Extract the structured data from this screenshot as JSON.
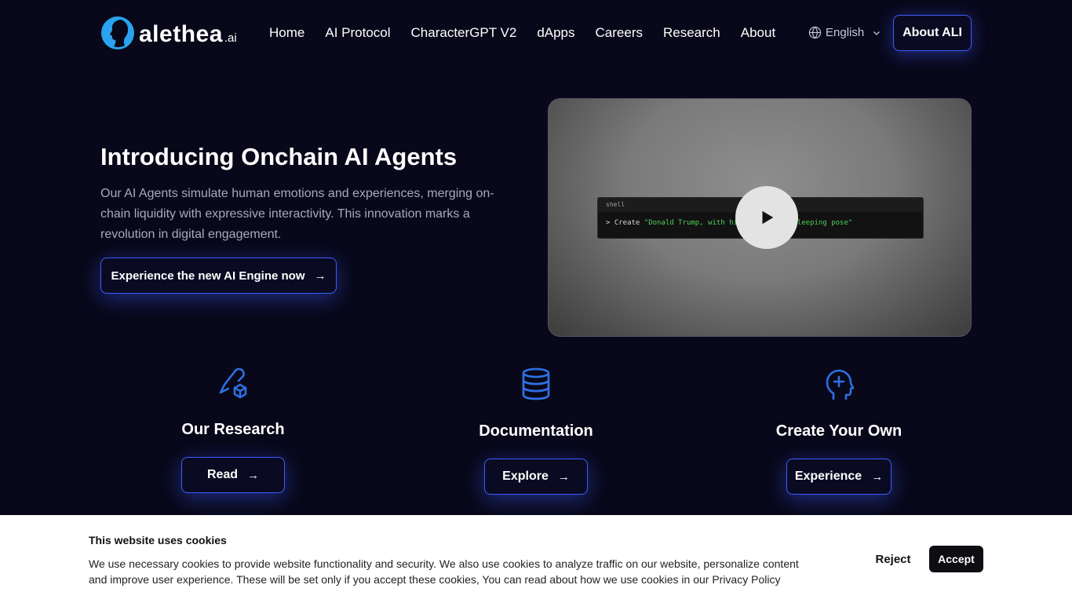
{
  "brand": {
    "name": "alethea",
    "suffix": ".ai",
    "accent": "#29a3f0"
  },
  "nav": {
    "items": [
      "Home",
      "AI Protocol",
      "CharacterGPT V2",
      "dApps",
      "Careers",
      "Research",
      "About"
    ],
    "language": "English",
    "cta_label": "About ALI"
  },
  "hero": {
    "title": "Introducing Onchain AI Agents",
    "description": "Our AI Agents simulate human emotions and experiences, merging on-chain liquidity with expressive interactivity. This innovation marks a revolution in digital engagement.",
    "cta_label": "Experience the new AI Engine now",
    "cta_arrow": "→"
  },
  "video": {
    "shell_label": "shell",
    "prompt": "> Create",
    "command_text": "\"Donald Trump, with his hands in a sleeping pose\""
  },
  "features": [
    {
      "icon": "research-icon",
      "title": "Our Research",
      "button": "Read",
      "arrow": "→"
    },
    {
      "icon": "database-icon",
      "title": "Documentation",
      "button": "Explore",
      "arrow": "→"
    },
    {
      "icon": "head-plus-icon",
      "title": "Create Your Own",
      "button": "Experience",
      "arrow": "→"
    }
  ],
  "cookie": {
    "title": "This website uses cookies",
    "text": "We use necessary cookies to provide website functionality and security. We also use cookies to analyze traffic on our website, personalize content and improve user experience. These will be set only if you accept these cookies, You can read about how we use cookies in our Privacy Policy",
    "reject_label": "Reject",
    "accept_label": "Accept"
  },
  "colors": {
    "background": "#08081a",
    "button_border": "#3d5cff",
    "icon_blue": "#2f6fe0"
  }
}
